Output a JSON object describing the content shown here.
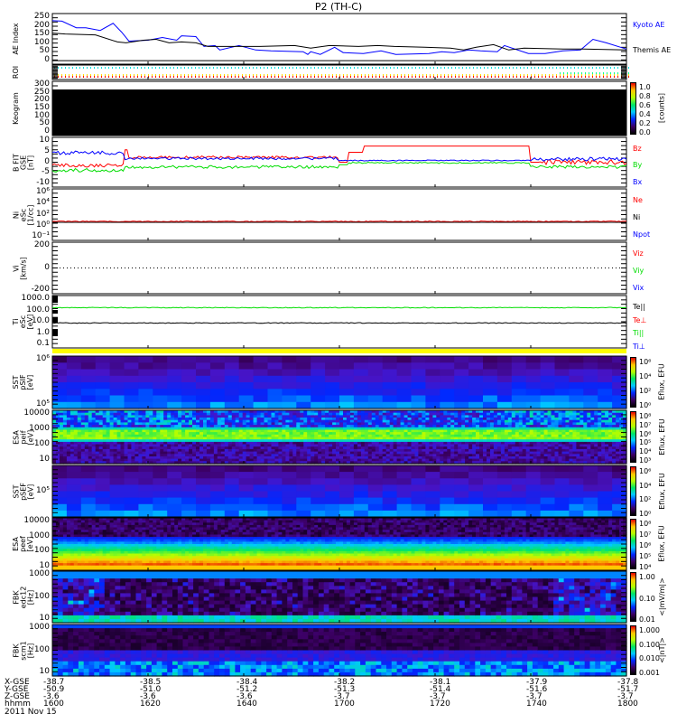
{
  "title": "P2 (TH-C)",
  "colors": {
    "kyoto": "#0000ff",
    "themis": "#000000",
    "bz": "#ff0000",
    "by": "#00dd00",
    "bx": "#0000ff",
    "yellow_bar": "#ffff00"
  },
  "panels": [
    {
      "id": "ae",
      "ylabel": [
        "AE Index"
      ],
      "yticks": [
        "250",
        "200",
        "150",
        "100",
        "50",
        "0"
      ],
      "legend": [
        {
          "text": "Kyoto AE",
          "color": "#0000ff"
        },
        {
          "text": "Themis AE",
          "color": "#000000"
        }
      ]
    },
    {
      "id": "roi",
      "ylabel": [
        "ROI"
      ],
      "yticks": [],
      "legend": []
    },
    {
      "id": "keogram",
      "ylabel": [
        "Keogram"
      ],
      "yticks": [
        "300",
        "250",
        "200",
        "150",
        "100",
        "50",
        "0"
      ],
      "legend": [],
      "colorbar": {
        "ticks": [
          "1.0",
          "0.8",
          "0.6",
          "0.4",
          "0.2",
          "0.0"
        ],
        "label": "[counts]"
      }
    },
    {
      "id": "bfit",
      "ylabel": [
        "B FIT",
        "GSE",
        "[nT]"
      ],
      "yticks": [
        "10",
        "5",
        "0",
        "-5",
        "-10"
      ],
      "legend": [
        {
          "text": "Bz",
          "color": "#ff0000"
        },
        {
          "text": "By",
          "color": "#00dd00"
        },
        {
          "text": "Bx",
          "color": "#0000ff"
        }
      ]
    },
    {
      "id": "ni",
      "ylabel": [
        "Ni",
        "eSc",
        "[1/cc]"
      ],
      "yticks": [
        "10⁶",
        "10⁴",
        "10²",
        "10⁰",
        "10⁻¹"
      ],
      "legend": [
        {
          "text": "Ne",
          "color": "#ff0000"
        },
        {
          "text": "Ni",
          "color": "#000000"
        },
        {
          "text": "Npot",
          "color": "#0000ff"
        }
      ]
    },
    {
      "id": "vi",
      "ylabel": [
        "Vi",
        "[km/s]"
      ],
      "yticks": [
        "200",
        "0",
        "-200"
      ],
      "legend": [
        {
          "text": "Viz",
          "color": "#ff0000"
        },
        {
          "text": "Viy",
          "color": "#00dd00"
        },
        {
          "text": "Vix",
          "color": "#0000ff"
        }
      ]
    },
    {
      "id": "ti",
      "ylabel": [
        "Ti",
        "eSc",
        "[eV]"
      ],
      "yticks": [
        "1000.0",
        "100.0",
        "10.0",
        "1.0",
        "0.1"
      ],
      "legend": [
        {
          "text": "Te||",
          "color": "#000000"
        },
        {
          "text": "Te⊥",
          "color": "#ff0000"
        },
        {
          "text": "Ti||",
          "color": "#00dd00"
        },
        {
          "text": "Ti⊥",
          "color": "#0000ff"
        }
      ]
    },
    {
      "id": "sst_i",
      "ylabel": [
        "SST",
        "pSIF",
        "[eV]"
      ],
      "yticks": [
        "10⁶",
        "10⁵"
      ],
      "legend": [],
      "colorbar": {
        "ticks": [
          "10⁶",
          "10⁴",
          "10²",
          "10⁰"
        ],
        "label": "Eflux, EFU"
      }
    },
    {
      "id": "esa_i",
      "ylabel": [
        "ESA",
        "peif",
        "[eV]"
      ],
      "yticks": [
        "10000",
        "1000",
        "100",
        "10"
      ],
      "legend": [],
      "colorbar": {
        "ticks": [
          "10⁸",
          "10⁷",
          "10⁶",
          "10⁵",
          "10⁴",
          "10³"
        ],
        "label": "Eflux, EFU"
      }
    },
    {
      "id": "sst_e",
      "ylabel": [
        "SST",
        "pSEF",
        "[eV]"
      ],
      "yticks": [
        "10⁵"
      ],
      "legend": [],
      "colorbar": {
        "ticks": [
          "10⁶",
          "10⁴",
          "10²",
          "10⁰"
        ],
        "label": "Eflux, EFU"
      }
    },
    {
      "id": "esa_e",
      "ylabel": [
        "ESA",
        "peef",
        "[eV]"
      ],
      "yticks": [
        "10000",
        "1000",
        "100",
        "10"
      ],
      "legend": [],
      "colorbar": {
        "ticks": [
          "10⁸",
          "10⁷",
          "10⁶",
          "10⁵",
          "10⁴"
        ],
        "label": "Eflux, EFU"
      }
    },
    {
      "id": "fbk_e",
      "ylabel": [
        "FBK",
        "edc12",
        "[Hz]"
      ],
      "yticks": [
        "1000",
        "100",
        "10"
      ],
      "legend": [],
      "colorbar": {
        "ticks": [
          "1.00",
          "0.10",
          "0.01"
        ],
        "label": "<|mV/m|>"
      }
    },
    {
      "id": "fbk_b",
      "ylabel": [
        "FBK",
        "scm1",
        "[Hz]"
      ],
      "yticks": [
        "1000",
        "100",
        "10"
      ],
      "legend": [],
      "colorbar": {
        "ticks": [
          "1.000",
          "0.100",
          "0.010",
          "0.001"
        ],
        "label": "<|nT|>"
      }
    }
  ],
  "xaxis": {
    "rows": [
      {
        "label": "X-GSE",
        "values": [
          "-38.7",
          "-38.5",
          "-38.4",
          "-38.2",
          "-38.1",
          "-37.9",
          "-37.8"
        ]
      },
      {
        "label": "Y-GSE",
        "values": [
          "-50.9",
          "-51.0",
          "-51.2",
          "-51.3",
          "-51.4",
          "-51.6",
          "-51.7"
        ]
      },
      {
        "label": "Z-GSE",
        "values": [
          "-3.6",
          "-3.6",
          "-3.6",
          "-3.7",
          "-3.7",
          "-3.7",
          "-3.7"
        ]
      },
      {
        "label": "hhmm",
        "values": [
          "1600",
          "1620",
          "1640",
          "1700",
          "1720",
          "1740",
          "1800"
        ]
      }
    ],
    "date": "2011 Nov 15"
  },
  "chart_data": {
    "type": "line",
    "title": "P2 (TH-C)",
    "xlabel": "hhmm",
    "xlim_minutes": [
      0,
      120
    ],
    "ylabel": "AE Index",
    "ylim": [
      -20,
      265
    ],
    "series": [
      {
        "name": "Kyoto AE",
        "x": [
          0,
          2,
          5,
          7,
          10,
          12.7,
          14.5,
          16,
          20,
          23,
          26,
          27,
          30,
          31.7,
          34,
          35,
          39,
          42.5,
          45.7,
          52.4,
          53.4,
          54,
          56,
          59,
          60.8,
          65,
          68.7,
          71.8,
          78.7,
          81.4,
          84,
          87,
          89.5,
          93,
          94.5,
          99.5,
          103,
          106.7,
          110.4,
          113,
          115.8,
          120
        ],
        "values": [
          225,
          222,
          185,
          185,
          170,
          210,
          160,
          110,
          115,
          130,
          115,
          140,
          135,
          80,
          85,
          60,
          85,
          60,
          55,
          50,
          35,
          50,
          35,
          75,
          45,
          40,
          55,
          35,
          40,
          50,
          45,
          60,
          55,
          50,
          85,
          40,
          40,
          55,
          60,
          120,
          100,
          65
        ]
      },
      {
        "name": "Themis AE",
        "x": [
          0,
          2.7,
          9,
          13.6,
          15.4,
          19,
          21.7,
          24.4,
          27,
          30,
          32.5,
          37,
          43.4,
          50.6,
          54,
          57.9,
          64,
          68,
          71.5,
          77.8,
          83.2,
          86,
          88.6,
          92.2,
          95.4,
          98.6,
          106.7,
          111,
          120
        ],
        "values": [
          155,
          150,
          145,
          105,
          100,
          115,
          120,
          100,
          105,
          100,
          80,
          80,
          80,
          85,
          70,
          85,
          80,
          85,
          80,
          75,
          70,
          60,
          75,
          90,
          60,
          70,
          65,
          65,
          60
        ]
      }
    ]
  }
}
